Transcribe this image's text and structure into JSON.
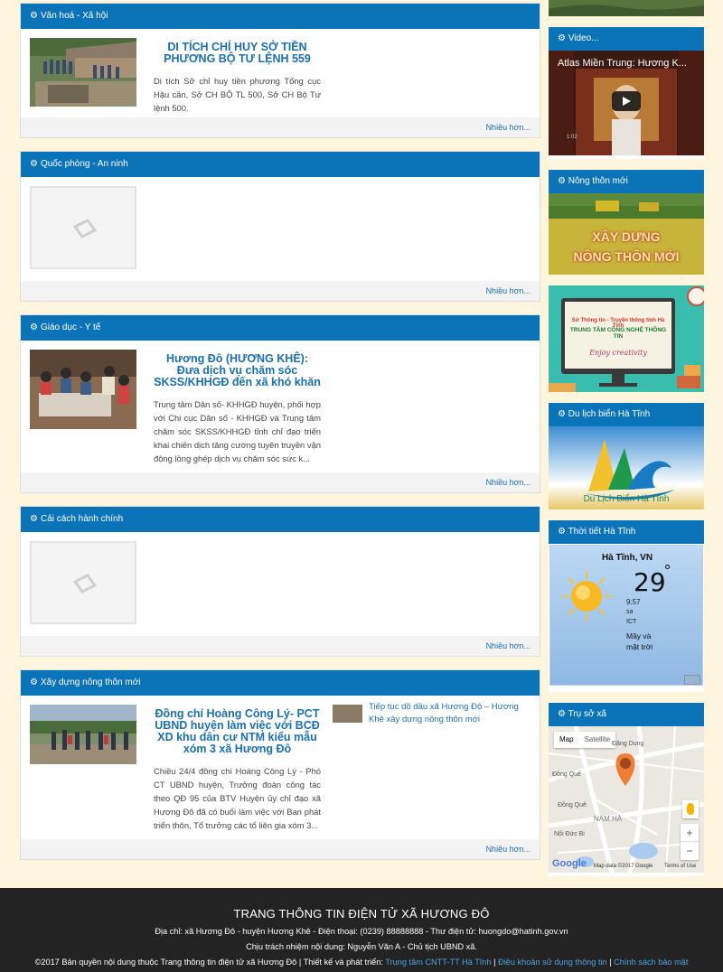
{
  "sections": [
    {
      "header": "Văn hoá - Xã hội",
      "title": "DI TÍCH CHỈ HUY SỞ TIỀN PHƯƠNG BỘ TƯ LỆNH 559",
      "desc": "Di tích Sở chỉ huy tiền phương Tổng cục Hậu cần, Sở CH BỘ TL 500, Sở CH Bộ Tư lệnh 500.",
      "more": "Nhiều hơn..."
    },
    {
      "header": "Quốc phòng - An ninh",
      "more": "Nhiều hơn..."
    },
    {
      "header": "Giáo dục - Y tế",
      "title": "Hương Đô (HƯƠNG KHÊ): Đưa dịch vụ chăm sóc SKSS/KHHGĐ đến xã khó khăn",
      "desc": "Trung tâm Dân số- KHHGĐ huyện, phối hợp với Chi cục Dân số - KHHGĐ và Trung tâm chăm sóc SKSS/KHHGĐ tỉnh chỉ đạo triển khai chiến dịch tăng cường tuyên truyền vận động lồng ghép dịch vụ chăm sóc sức k...",
      "more": "Nhiều hơn..."
    },
    {
      "header": "Cải cách hành chính",
      "more": "Nhiều hơn..."
    },
    {
      "header": "Xây dựng nông thôn mới",
      "title": "Đồng chí Hoàng Công Lý- PCT UBND huyện làm việc với BCĐ XD khu dân cư NTM kiểu mẫu xóm 3 xã Hương Đô",
      "desc": "Chiều 24/4 đồng chí Hoàng Công Lý - Phó CT UBND huyện, Trưởng đoàn công tác theo QĐ 95 của BTV Huyện ủy chỉ đạo xã Hương Đô đã có buổi làm việc với Ban phát triển thôn, Tổ trưởng các tổ liên gia xóm 3...",
      "related": "Tiếp tục dồ dầu xã Hương Đô – Hương Khê xây dựng nông thôn mới",
      "more": "Nhiều hơn..."
    }
  ],
  "sidebar": {
    "video_header": "Video...",
    "video_title": "Atlas Miền Trung: Hương K...",
    "video_time": "1:02",
    "ntm_header": "Nông thôn mới",
    "ntm_banner_line1": "XÂY DỰNG",
    "ntm_banner_line2": "NÔNG THÔN MỚI",
    "cntt_line1": "Sở Thông tin - Truyền thông tỉnh Hà Tĩnh",
    "cntt_line2": "TRUNG TÂM CÔNG NGHỆ THÔNG TIN",
    "cntt_line3": "Enjoy creativity",
    "dulich_header": "Du lịch biển Hà Tĩnh",
    "dulich_caption": "Du Lịch Biển Hà Tĩnh",
    "weather_header": "Thời tiết Hà Tĩnh",
    "weather_city": "Hà Tĩnh, VN",
    "weather_temp": "29",
    "weather_deg": "°",
    "weather_time": "9:57",
    "weather_ampm": "sa",
    "weather_tz": "ICT",
    "weather_cond": "Mây và mặt trời",
    "map_header": "Trụ sở xã",
    "map_tab_map": "Map",
    "map_tab_sat": "Satellite",
    "map_labels": [
      "Đặng Dung",
      "Đồng Quế",
      "NAM HÀ",
      "Nội Đức Bi",
      "Đồng Quê"
    ],
    "map_zoom_in": "+",
    "map_zoom_out": "−",
    "map_google": "Google",
    "map_data": "Map data ©2017 Google",
    "map_terms": "Terms of Use"
  },
  "footer": {
    "title": "TRANG THÔNG TIN ĐIỆN TỬ XÃ HƯƠNG ĐÔ",
    "address": "Địa chỉ: xã Hương Đô - huyện Hương Khê - Điện thoại: (0239) 88888888 - Thư điện tử: huongdo@hatinh.gov.vn",
    "responsible": "Chịu trách nhiệm nội dung: Nguyễn Văn A - Chủ tịch UBND xã.",
    "copyright": "©2017 Bản quyền nội dung thuộc Trang thông tin điện tử xã Hương Đô | Thiết kế và phát triển: ",
    "link1": "Trung tâm CNTT-TT Hà Tĩnh",
    "sep": " | ",
    "link2": "Điều khoản sử dụng thông tin",
    "link3": "Chính sách bảo mật"
  },
  "colors": {
    "header_blue": "#0b73b8",
    "link_blue": "#1a6fae",
    "background": "#fdf6dc",
    "footer_bg": "#232323"
  }
}
